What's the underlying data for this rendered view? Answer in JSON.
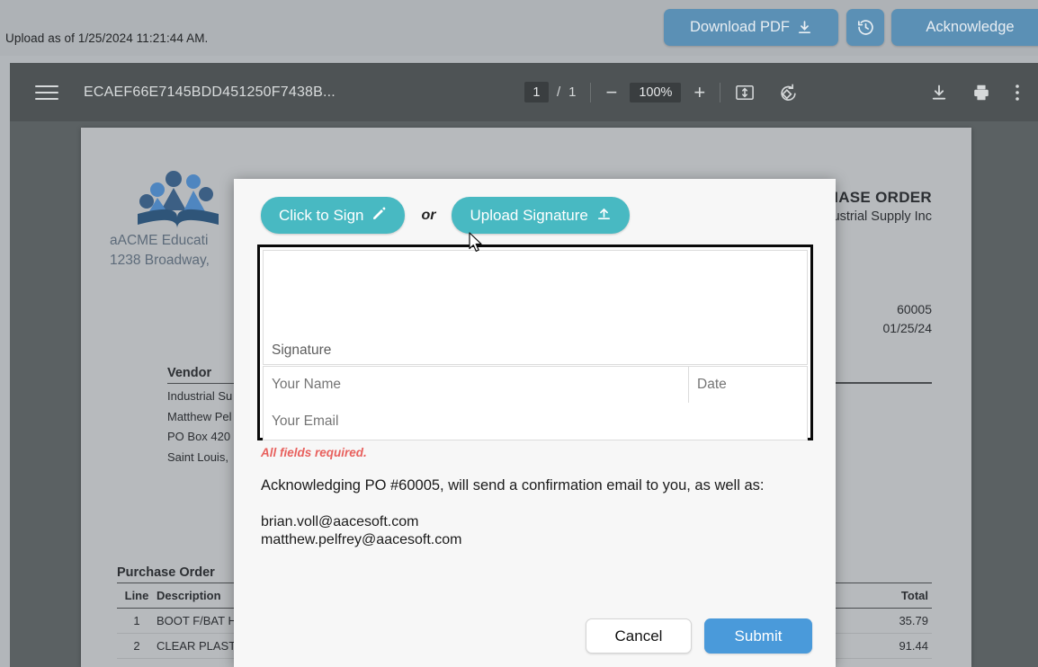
{
  "appbar": {
    "upload_note": "Upload as of 1/25/2024 11:21:44 AM.",
    "download_pdf_label": "Download PDF",
    "download_icon": "download-icon",
    "history_icon": "history-clock-icon",
    "acknowledge_label": "Acknowledge",
    "button_color": "#5b90b5"
  },
  "pdf_toolbar": {
    "menu_icon": "hamburger-menu-icon",
    "filename": "ECAEF66E7145BDD451250F7438B...",
    "page_current": "1",
    "page_separator": "/",
    "page_total": "1",
    "zoom_out_icon": "minus-icon",
    "zoom_value": "100%",
    "zoom_in_icon": "plus-icon",
    "fit_icon": "fit-page-icon",
    "rotate_icon": "rotate-counterclockwise-icon",
    "download_icon": "download-icon",
    "print_icon": "printer-icon",
    "more_icon": "more-vertical-icon"
  },
  "pdf_page": {
    "logo_icon": "aacme-education-people-book-logo",
    "company_line1": "aACME Educati",
    "company_line2": "1238 Broadway,",
    "doc_title": "HASE ORDER",
    "doc_subtitle": "ustrial Supply Inc",
    "po_number": "60005",
    "po_date": "01/25/24",
    "vendor_heading": "Vendor",
    "vendor_lines": [
      "Industrial Su",
      "Matthew Pel",
      "PO Box 420",
      "Saint Louis,"
    ],
    "table_caption": "Purchase Order",
    "columns": [
      "Line",
      "Description",
      "Total"
    ],
    "rows": [
      {
        "line": "1",
        "description": "BOOT F/BAT H",
        "total": "35.79"
      },
      {
        "line": "2",
        "description": "CLEAR PLAST",
        "total": "91.44"
      }
    ]
  },
  "modal": {
    "click_to_sign_label": "Click to Sign",
    "click_to_sign_icon": "pencil-icon",
    "or_label": "or",
    "upload_signature_label": "Upload Signature",
    "upload_signature_icon": "upload-icon",
    "teal_color": "#48b9c2",
    "signature_placeholder": "Signature",
    "name_placeholder": "Your Name",
    "date_placeholder": "Date",
    "email_placeholder": "Your Email",
    "signature_value": "",
    "name_value": "",
    "date_value": "",
    "email_value": "",
    "required_note": "All fields required.",
    "required_color": "#e8615e",
    "acknowledge_text": "Acknowledging PO #60005, will send a confirmation email to you, as well as:",
    "emails": [
      "brian.voll@aacesoft.com",
      "matthew.pelfrey@aacesoft.com"
    ],
    "cancel_label": "Cancel",
    "submit_label": "Submit",
    "submit_color": "#4a9ada"
  },
  "cursor": {
    "icon": "mouse-pointer-cursor"
  }
}
